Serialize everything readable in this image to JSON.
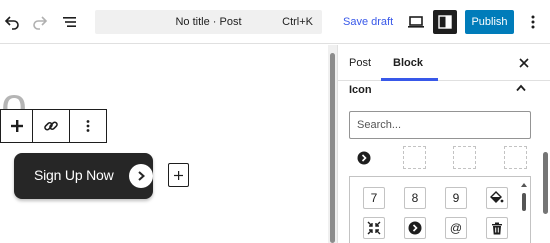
{
  "header": {
    "doc_title": "No title · Post",
    "shortcut": "Ctrl+K",
    "save_draft": "Save draft",
    "publish": "Publish",
    "icons": {
      "undo": "undo-icon",
      "redo": "redo-icon",
      "list_view": "list-view-icon",
      "preview": "preview-laptop-icon",
      "settings": "sidebar-toggle-icon",
      "options": "vertical-ellipsis-icon"
    }
  },
  "canvas": {
    "heading_fragment": "lo",
    "button_text": "Sign Up Now",
    "block_toolbar": {
      "icons": [
        "drag-handle-icon",
        "link-icon",
        "more-options-icon"
      ]
    },
    "inserter_symbol": "+"
  },
  "sidebar": {
    "tabs": [
      {
        "label": "Post",
        "active": false
      },
      {
        "label": "Block",
        "active": true
      }
    ],
    "close_symbol": "×",
    "panel_title": "Icon",
    "search": {
      "placeholder": "Search...",
      "value": ""
    },
    "selected_icon": "chevron-right-circle-icon",
    "icon_grid": {
      "row1": [
        "7",
        "8",
        "9",
        "paint-bucket-icon"
      ],
      "row2": [
        "collapse-icon",
        "chevron-right-circle-icon",
        "@",
        "trash-icon"
      ]
    }
  },
  "colors": {
    "accent_blue": "#3858e9",
    "publish_blue": "#007cba",
    "button_dark": "#262626",
    "text_dark": "#1e1e1e"
  }
}
